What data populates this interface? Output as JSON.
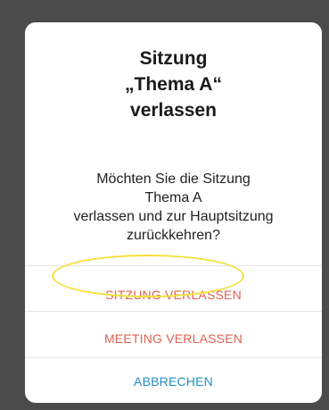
{
  "dialog": {
    "title_lines": [
      "Sitzung",
      "„Thema A“",
      "verlassen"
    ],
    "message_lines": [
      "Möchten Sie die Sitzung",
      "Thema A",
      "verlassen und zur Hauptsitzung",
      "zurückkehren?"
    ],
    "actions": {
      "leave_session": "SITZUNG VERLASSEN",
      "leave_meeting": "MEETING VERLASSEN",
      "cancel": "ABBRECHEN"
    }
  },
  "colors": {
    "scrim": "#4b4b4b",
    "danger": "#e0614f",
    "cancel": "#1e8fc0",
    "highlight": "#f3e13a"
  }
}
